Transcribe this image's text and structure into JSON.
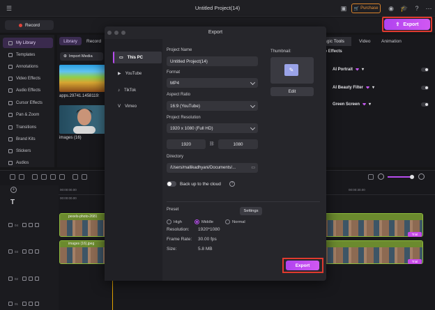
{
  "window": {
    "title": "Untitled Project(14)",
    "purchase_label": "Purchase"
  },
  "toolbar": {
    "record_label": "Record",
    "export_label": "Export"
  },
  "sidebar": {
    "items": [
      {
        "label": "My Library",
        "active": true
      },
      {
        "label": "Templates"
      },
      {
        "label": "Annotations"
      },
      {
        "label": "Video Effects"
      },
      {
        "label": "Audio Effects"
      },
      {
        "label": "Cursor Effects"
      },
      {
        "label": "Pan & Zoom"
      },
      {
        "label": "Transitions"
      },
      {
        "label": "Brand Kits"
      },
      {
        "label": "Stickers"
      },
      {
        "label": "Audios"
      }
    ]
  },
  "library": {
    "tabs": [
      "Library",
      "Record"
    ],
    "import_label": "Import Media",
    "items": [
      {
        "name": "apps.29741.1458119:"
      },
      {
        "name": "images (16)"
      }
    ]
  },
  "right_panel": {
    "tabs": [
      "agic Tools",
      "Video",
      "Animation"
    ],
    "section": "eo Effects",
    "items": [
      {
        "label": "AI Portrait"
      },
      {
        "label": "AI Beauty Filter"
      },
      {
        "label": "Green Screen"
      }
    ]
  },
  "timeline": {
    "timecodes": [
      "00:00:00.00",
      "00:00:00.00",
      "00:00:10.00",
      "00:00:20.00",
      "00:00:30.00"
    ],
    "tracks": [
      "04",
      "03",
      "02",
      "01"
    ],
    "clips": [
      {
        "name": "pexels-photo-2681"
      },
      {
        "name": "images (16).jpeg"
      }
    ],
    "trial_label": "Trial"
  },
  "dialog": {
    "title": "Export",
    "nav": [
      "This PC",
      "YouTube",
      "TikTok",
      "Vimeo"
    ],
    "project_name_label": "Project Name",
    "project_name": "Untitled Project(14)",
    "format_label": "Format",
    "format": "MP4",
    "aspect_label": "Aspect Ratio",
    "aspect": "16:9 (YouTube)",
    "resolution_label": "Project Resolution",
    "resolution": "1920 x 1080 (Full HD)",
    "width": "1920",
    "height": "1080",
    "directory_label": "Directory",
    "directory": "/Users/mallikadhyani/Documents/...",
    "cloud_label": "Back up to the cloud",
    "thumbnail_label": "Thumbnail:",
    "edit_label": "Edit",
    "preset_label": "Preset",
    "settings_label": "Settings",
    "preset_options": [
      "High",
      "Middle",
      "Normal"
    ],
    "selected_preset": "Middle",
    "info": {
      "resolution_key": "Resolution:",
      "resolution_val": "1920*1080",
      "framerate_key": "Frame Rate:",
      "framerate_val": "30.00 fps",
      "size_key": "Size:",
      "size_val": "5.8 MB"
    },
    "export_label": "Export"
  },
  "colors": {
    "accent": "#b84cef",
    "highlight_frame": "#e03a2f"
  }
}
